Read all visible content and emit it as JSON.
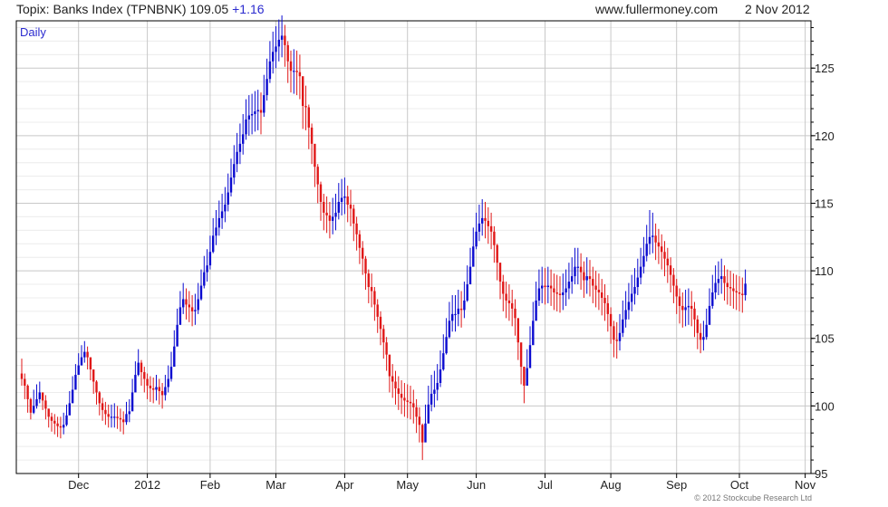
{
  "header": {
    "title": "Topix: Banks Index (TPNBNK) 109.05",
    "change": "+1.16",
    "website": "www.fullermoney.com",
    "date": "2 Nov 2012"
  },
  "footer": {
    "copyright": "© 2012 Stockcube Research Ltd"
  },
  "colors": {
    "up": "#0b0bd0",
    "down": "#e01818",
    "grid": "#c8c8c8",
    "axis": "#000000"
  },
  "chart_data": {
    "type": "candlestick",
    "period_label": "Daily",
    "ylim": [
      95,
      128.5
    ],
    "y_ticks": [
      95,
      100,
      105,
      110,
      115,
      120,
      125
    ],
    "x_tick_labels": [
      "Dec",
      "2012",
      "Feb",
      "Mar",
      "Apr",
      "May",
      "Jun",
      "Jul",
      "Aug",
      "Sep",
      "Oct",
      "Nov"
    ],
    "x_tick_index": [
      19,
      42,
      63,
      85,
      108,
      129,
      152,
      175,
      197,
      219,
      240,
      262
    ],
    "grid": true,
    "close_series": [
      102,
      101.5,
      100.5,
      99.5,
      100,
      100.5,
      101,
      100.4,
      99.8,
      99.2,
      98.9,
      98.7,
      98.5,
      98.4,
      98.6,
      99.3,
      100.2,
      101.2,
      102.3,
      103,
      103.6,
      104,
      103.6,
      102.7,
      101.8,
      101,
      100.2,
      99.7,
      99.4,
      99.2,
      99.2,
      99.2,
      99.1,
      99,
      98.8,
      99.4,
      99.6,
      101,
      102.3,
      103.2,
      102.5,
      102,
      101.5,
      101.3,
      101.2,
      101.4,
      101.1,
      100.8,
      101.4,
      102,
      102.9,
      104.4,
      106,
      107.3,
      107.9,
      107.5,
      107.3,
      107,
      107.1,
      107.9,
      108.9,
      109.9,
      110.4,
      111.4,
      112.6,
      113.2,
      113.9,
      114.4,
      114.9,
      115.8,
      116.9,
      117.9,
      118.8,
      119.4,
      120.1,
      121.2,
      121.5,
      121.6,
      121.8,
      121.9,
      121.7,
      123,
      124.2,
      125.5,
      126.2,
      126.6,
      127.1,
      127.4,
      126.7,
      125.5,
      124.8,
      124.8,
      124.7,
      124.4,
      122.2,
      122.1,
      120.6,
      119.4,
      117.7,
      116.4,
      115.1,
      114.3,
      114.1,
      113.7,
      114,
      114.3,
      115.1,
      115.4,
      115.5,
      114.9,
      114.6,
      113.5,
      112.7,
      111.7,
      110.9,
      109.8,
      108.8,
      108.5,
      107.5,
      106.6,
      105.7,
      104.7,
      103.8,
      102.2,
      101.8,
      101.3,
      100.9,
      100.6,
      100.4,
      100.3,
      100.2,
      99.9,
      99.2,
      98.6,
      97.3,
      98.7,
      100.1,
      100.9,
      101.2,
      101.7,
      102.7,
      103.9,
      105.1,
      106.3,
      106.8,
      106.8,
      107.2,
      107.1,
      107.8,
      109,
      110.3,
      111.8,
      112.9,
      113.5,
      113.9,
      113.7,
      113.3,
      112.9,
      111.9,
      110.6,
      109.2,
      108.3,
      107.8,
      107.6,
      107.2,
      106.5,
      104.7,
      102.9,
      101.5,
      102.8,
      104.5,
      106.3,
      107.8,
      108.7,
      108.9,
      108.8,
      108.9,
      108.7,
      108.4,
      108.3,
      108.2,
      108.4,
      108.7,
      109.2,
      109.6,
      110.3,
      110.3,
      109.9,
      109.3,
      109.6,
      109.4,
      108.9,
      108.6,
      108.4,
      108,
      107.6,
      106.8,
      105.9,
      104.9,
      104.8,
      105.4,
      106.4,
      107.1,
      107.7,
      108.3,
      108.8,
      109.5,
      110.3,
      111.1,
      112,
      112.5,
      112.6,
      112.1,
      111.8,
      111.4,
      110.9,
      110.4,
      109.7,
      108.9,
      108.1,
      107.4,
      107.1,
      107.3,
      107.4,
      107.2,
      106.4,
      105.4,
      104.9,
      105.1,
      106,
      107.4,
      108.4,
      109.1,
      109.4,
      109.6,
      109.1,
      108.8,
      108.7,
      108.5,
      108.4,
      108.3,
      108.2,
      109.05
    ],
    "session_ranges": [
      [
        101.5,
        103.5
      ],
      [
        100.5,
        102.4
      ],
      [
        99.5,
        101.6
      ],
      [
        99,
        100.6
      ],
      [
        99.4,
        101.2
      ],
      [
        99.8,
        101.6
      ],
      [
        100.2,
        101.8
      ],
      [
        99.7,
        101
      ],
      [
        99,
        100.8
      ],
      [
        98.4,
        99.8
      ],
      [
        98.1,
        99.5
      ],
      [
        97.9,
        99.4
      ],
      [
        97.7,
        99.2
      ],
      [
        97.6,
        99.2
      ],
      [
        97.9,
        99.5
      ],
      [
        98.5,
        100.1
      ],
      [
        99.4,
        101.1
      ],
      [
        100.5,
        102.2
      ],
      [
        101.5,
        103.1
      ],
      [
        102.4,
        103.9
      ],
      [
        103,
        104.5
      ],
      [
        103.2,
        104.8
      ],
      [
        102.7,
        104.4
      ],
      [
        101.9,
        103.6
      ],
      [
        100.9,
        102.6
      ],
      [
        100.1,
        101.9
      ],
      [
        99.3,
        101.1
      ],
      [
        98.9,
        100.6
      ],
      [
        98.6,
        100.3
      ],
      [
        98.4,
        100.1
      ],
      [
        98.4,
        100.1
      ],
      [
        98.4,
        100.2
      ],
      [
        98.3,
        100
      ],
      [
        98.1,
        99.8
      ],
      [
        97.9,
        99.6
      ],
      [
        98.6,
        100.3
      ],
      [
        98.8,
        100.5
      ],
      [
        100,
        102
      ],
      [
        101.3,
        103.3
      ],
      [
        102.2,
        104.2
      ],
      [
        101.5,
        103.4
      ],
      [
        101,
        102.9
      ],
      [
        100.5,
        102.4
      ],
      [
        100.3,
        102.2
      ],
      [
        100.2,
        102.1
      ],
      [
        100.4,
        102.3
      ],
      [
        100.1,
        102
      ],
      [
        99.8,
        101.7
      ],
      [
        100.4,
        102.3
      ],
      [
        101,
        103
      ],
      [
        101.8,
        104
      ],
      [
        103.2,
        105.6
      ],
      [
        104.8,
        107.2
      ],
      [
        106.1,
        108.5
      ],
      [
        106.8,
        109.1
      ],
      [
        106.4,
        108.7
      ],
      [
        106.2,
        108.5
      ],
      [
        105.9,
        108.2
      ],
      [
        106,
        108.3
      ],
      [
        106.8,
        109.1
      ],
      [
        107.8,
        110.1
      ],
      [
        108.7,
        111.1
      ],
      [
        109.2,
        111.6
      ],
      [
        110.1,
        112.6
      ],
      [
        111.3,
        113.9
      ],
      [
        111.9,
        114.5
      ],
      [
        112.6,
        115.2
      ],
      [
        113.1,
        115.7
      ],
      [
        113.6,
        116.2
      ],
      [
        114.4,
        117.2
      ],
      [
        115.5,
        118.3
      ],
      [
        116.4,
        119.3
      ],
      [
        117.3,
        120.2
      ],
      [
        117.9,
        120.9
      ],
      [
        118.6,
        121.6
      ],
      [
        119.7,
        122.7
      ],
      [
        120,
        123
      ],
      [
        120.1,
        123.1
      ],
      [
        120.3,
        123.3
      ],
      [
        120.4,
        123.4
      ],
      [
        120.1,
        123.2
      ],
      [
        121.4,
        124.5
      ],
      [
        122.6,
        125.7
      ],
      [
        123.9,
        127
      ],
      [
        124.6,
        127.7
      ],
      [
        125,
        128.1
      ],
      [
        125.5,
        128.6
      ],
      [
        125.8,
        128.9
      ],
      [
        125.1,
        128.2
      ],
      [
        123.9,
        127
      ],
      [
        123.2,
        126.3
      ],
      [
        123.1,
        126.4
      ],
      [
        123,
        126.3
      ],
      [
        122.7,
        126
      ],
      [
        120.5,
        123.8
      ],
      [
        120.4,
        123.7
      ],
      [
        119,
        122.3
      ],
      [
        117.9,
        120.9
      ],
      [
        116.2,
        119.2
      ],
      [
        115,
        117.9
      ],
      [
        113.7,
        116.6
      ],
      [
        113,
        115.7
      ],
      [
        112.8,
        115.5
      ],
      [
        112.4,
        115.1
      ],
      [
        112.7,
        115.4
      ],
      [
        113,
        115.7
      ],
      [
        113.8,
        116.5
      ],
      [
        114.1,
        116.8
      ],
      [
        114.2,
        116.9
      ],
      [
        113.6,
        116.3
      ],
      [
        113.3,
        116
      ],
      [
        112.2,
        114.9
      ],
      [
        111.5,
        114
      ],
      [
        110.5,
        113
      ],
      [
        109.7,
        112.2
      ],
      [
        108.6,
        111.1
      ],
      [
        107.6,
        110.1
      ],
      [
        107.3,
        109.8
      ],
      [
        106.3,
        108.8
      ],
      [
        105.4,
        107.9
      ],
      [
        104.5,
        107
      ],
      [
        103.5,
        106
      ],
      [
        102.6,
        105.1
      ],
      [
        101,
        103.5
      ],
      [
        100.6,
        103.1
      ],
      [
        100.1,
        102.6
      ],
      [
        99.7,
        102.2
      ],
      [
        99.4,
        101.9
      ],
      [
        99.2,
        101.7
      ],
      [
        99.1,
        101.6
      ],
      [
        99,
        101.5
      ],
      [
        98.7,
        101.2
      ],
      [
        98,
        100.5
      ],
      [
        97.3,
        99.9
      ],
      [
        96,
        98.7
      ],
      [
        97.4,
        100.1
      ],
      [
        98.8,
        101.5
      ],
      [
        99.6,
        102.3
      ],
      [
        99.9,
        102.6
      ],
      [
        100.4,
        103.1
      ],
      [
        101.4,
        104.1
      ],
      [
        102.6,
        105.3
      ],
      [
        103.8,
        106.5
      ],
      [
        105,
        107.7
      ],
      [
        105.5,
        108.2
      ],
      [
        105.5,
        108.2
      ],
      [
        105.9,
        108.6
      ],
      [
        105.8,
        108.5
      ],
      [
        106.5,
        109.2
      ],
      [
        107.7,
        110.4
      ],
      [
        109,
        111.7
      ],
      [
        110.4,
        113.2
      ],
      [
        111.6,
        114.3
      ],
      [
        112.2,
        114.9
      ],
      [
        112.6,
        115.3
      ],
      [
        112.4,
        115.1
      ],
      [
        112,
        114.7
      ],
      [
        111.6,
        114.3
      ],
      [
        110.6,
        113.3
      ],
      [
        109.3,
        112
      ],
      [
        107.9,
        110.6
      ],
      [
        107,
        109.7
      ],
      [
        106.5,
        109.2
      ],
      [
        106.3,
        109
      ],
      [
        105.9,
        108.6
      ],
      [
        105.2,
        107.9
      ],
      [
        103.4,
        106.1
      ],
      [
        101.6,
        104.3
      ],
      [
        100.2,
        102.9
      ],
      [
        101.5,
        104.2
      ],
      [
        103.2,
        105.9
      ],
      [
        105,
        107.7
      ],
      [
        106.5,
        109.2
      ],
      [
        107.4,
        110.1
      ],
      [
        107.6,
        110.3
      ],
      [
        107.5,
        110.2
      ],
      [
        107.6,
        110.3
      ],
      [
        107.4,
        110.1
      ],
      [
        107.1,
        109.8
      ],
      [
        107,
        109.7
      ],
      [
        106.9,
        109.6
      ],
      [
        107.1,
        109.8
      ],
      [
        107.4,
        110.1
      ],
      [
        107.9,
        110.6
      ],
      [
        108.3,
        111
      ],
      [
        109,
        111.7
      ],
      [
        109,
        111.7
      ],
      [
        108.6,
        111.3
      ],
      [
        108,
        110.7
      ],
      [
        108.3,
        111
      ],
      [
        108.1,
        110.8
      ],
      [
        107.6,
        110.3
      ],
      [
        107.3,
        110
      ],
      [
        107.1,
        109.8
      ],
      [
        106.7,
        109.4
      ],
      [
        106.3,
        109
      ],
      [
        105.5,
        108.2
      ],
      [
        104.6,
        107.3
      ],
      [
        103.6,
        106.3
      ],
      [
        103.5,
        106.2
      ],
      [
        104.1,
        106.8
      ],
      [
        105.1,
        107.8
      ],
      [
        105.8,
        108.5
      ],
      [
        106.4,
        109.1
      ],
      [
        107,
        109.7
      ],
      [
        107.5,
        110.2
      ],
      [
        108.2,
        110.9
      ],
      [
        109,
        111.7
      ],
      [
        109.8,
        112.5
      ],
      [
        110.7,
        113.4
      ],
      [
        111.2,
        114.5
      ],
      [
        111.3,
        114.3
      ],
      [
        110.8,
        113.5
      ],
      [
        110.5,
        113.1
      ],
      [
        110.1,
        112.7
      ],
      [
        109.6,
        112.2
      ],
      [
        109.1,
        111.7
      ],
      [
        108.4,
        111
      ],
      [
        107.6,
        110.2
      ],
      [
        106.8,
        109.4
      ],
      [
        106.1,
        108.7
      ],
      [
        105.8,
        108.4
      ],
      [
        105.9,
        108.6
      ],
      [
        106,
        108.7
      ],
      [
        105.9,
        108.5
      ],
      [
        105.1,
        107.7
      ],
      [
        104.2,
        106.7
      ],
      [
        103.9,
        106.1
      ],
      [
        104.1,
        106.3
      ],
      [
        104.9,
        107.2
      ],
      [
        106.2,
        108.7
      ],
      [
        107.2,
        109.7
      ],
      [
        107.9,
        110.4
      ],
      [
        108.2,
        110.7
      ],
      [
        108.3,
        110.9
      ],
      [
        107.8,
        110.4
      ],
      [
        107.5,
        110.1
      ],
      [
        107.4,
        110
      ],
      [
        107.2,
        109.8
      ],
      [
        107.1,
        109.7
      ],
      [
        107,
        109.6
      ],
      [
        106.9,
        109.5
      ],
      [
        107.8,
        110.1
      ]
    ]
  }
}
